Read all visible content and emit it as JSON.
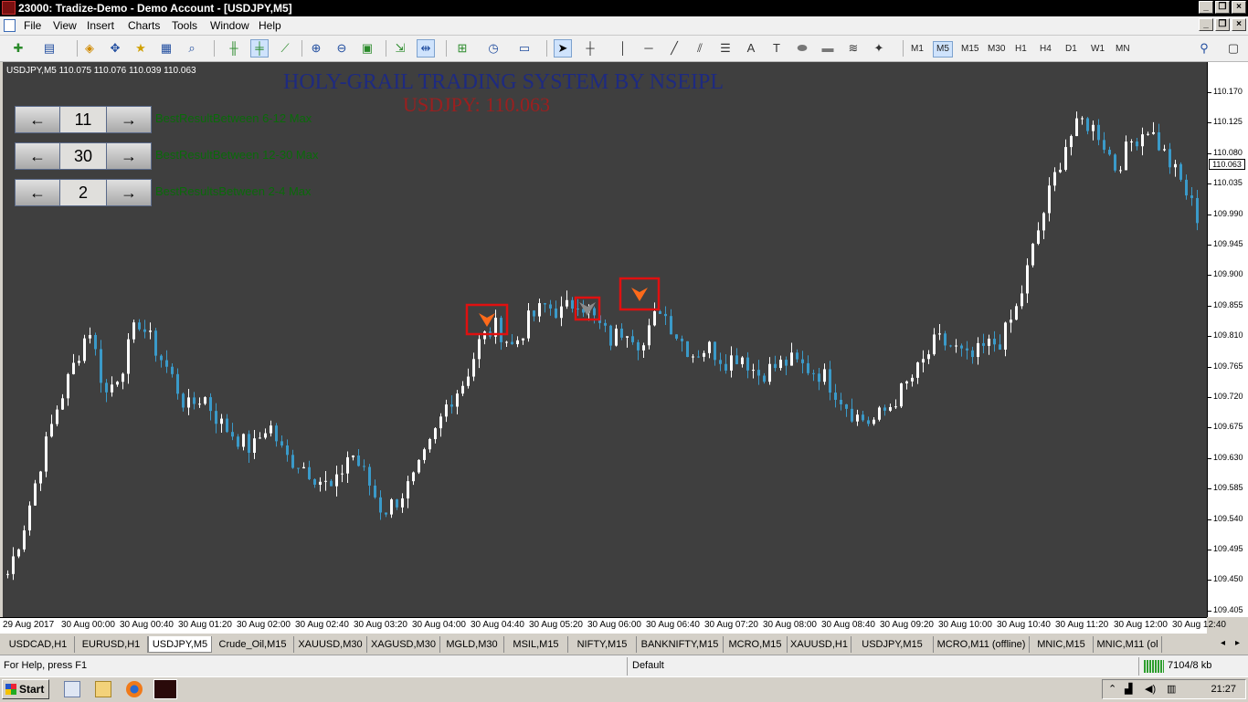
{
  "window": {
    "title": "23000: Tradize-Demo - Demo Account - [USDJPY,M5]"
  },
  "menu": [
    "File",
    "View",
    "Insert",
    "Charts",
    "Tools",
    "Window",
    "Help"
  ],
  "toolbar": {
    "timeframes": [
      "M1",
      "M5",
      "M15",
      "M30",
      "H1",
      "H4",
      "D1",
      "W1",
      "MN"
    ],
    "active_timeframe": "M5"
  },
  "chart": {
    "symbol_line": "USDJPY,M5  110.075 110.076 110.039 110.063",
    "title": "HOLY-GRAIL TRADING SYSTEM BY NSEIPL",
    "price_banner": "USDJPY: 110.063",
    "controls": [
      {
        "value": "11",
        "label": "BestResultBetween 6-12 Max"
      },
      {
        "value": "30",
        "label": "BestResultBetween 12-30 Max"
      },
      {
        "value": "2",
        "label": "BestResultsBetween 2-4 Max"
      }
    ],
    "left_arrow": "←",
    "right_arrow": "→",
    "current_price": "110.063",
    "price_axis": [
      "110.170",
      "110.125",
      "110.080",
      "110.035",
      "109.990",
      "109.945",
      "109.900",
      "109.855",
      "109.810",
      "109.765",
      "109.720",
      "109.675",
      "109.630",
      "109.585",
      "109.540",
      "109.495",
      "109.450",
      "109.405"
    ],
    "time_axis": [
      "29 Aug 2017",
      "30 Aug 00:00",
      "30 Aug 00:40",
      "30 Aug 01:20",
      "30 Aug 02:00",
      "30 Aug 02:40",
      "30 Aug 03:20",
      "30 Aug 04:00",
      "30 Aug 04:40",
      "30 Aug 05:20",
      "30 Aug 06:00",
      "30 Aug 06:40",
      "30 Aug 07:20",
      "30 Aug 08:00",
      "30 Aug 08:40",
      "30 Aug 09:20",
      "30 Aug 10:00",
      "30 Aug 10:40",
      "30 Aug 11:20",
      "30 Aug 12:00",
      "30 Aug 12:40"
    ],
    "colors": {
      "background": "#3f3f3f",
      "bull": "#ffffff",
      "bear": "#3a9ac9",
      "signal": "#ff6a1a",
      "signal_box": "#e01010"
    }
  },
  "chart_data": {
    "type": "candlestick",
    "symbol": "USDJPY",
    "timeframe": "M5",
    "ylim": [
      109.405,
      110.17
    ],
    "close_path": [
      109.46,
      109.53,
      109.62,
      109.7,
      109.76,
      109.82,
      109.72,
      109.76,
      109.83,
      109.79,
      109.75,
      109.7,
      109.72,
      109.68,
      109.66,
      109.64,
      109.68,
      109.63,
      109.62,
      109.6,
      109.58,
      109.64,
      109.6,
      109.55,
      109.57,
      109.6,
      109.65,
      109.71,
      109.74,
      109.8,
      109.82,
      109.79,
      109.83,
      109.85,
      109.84,
      109.86,
      109.83,
      109.8,
      109.82,
      109.79,
      109.85,
      109.81,
      109.78,
      109.79,
      109.77,
      109.78,
      109.75,
      109.76,
      109.77,
      109.76,
      109.75,
      109.72,
      109.69,
      109.68,
      109.7,
      109.73,
      109.76,
      109.8,
      109.79,
      109.77,
      109.79,
      109.8,
      109.85,
      109.94,
      110.02,
      110.09,
      110.12,
      110.1,
      110.05,
      110.09,
      110.11,
      110.07,
      110.03,
      109.98
    ],
    "signals": [
      {
        "time": "30 Aug 04:40",
        "type": "sell"
      },
      {
        "time": "30 Aug 05:30",
        "type": "sell"
      },
      {
        "time": "30 Aug 06:15",
        "type": "sell"
      }
    ]
  },
  "tabs": {
    "items": [
      "USDCAD,H1",
      "EURUSD,H1",
      "USDJPY,M5",
      "Crude_Oil,M15",
      "XAUUSD,M30",
      "XAGUSD,M30",
      "MGLD,M30",
      "MSIL,M15",
      "NIFTY,M15",
      "BANKNIFTY,M15",
      "MCRO,M15",
      "XAUUSD,H1",
      "USDJPY,M15",
      "MCRO,M11 (offline)",
      "MNIC,M15",
      "MNIC,M11 (ol"
    ],
    "active": "USDJPY,M5"
  },
  "status": {
    "help": "For Help, press F1",
    "profile": "Default",
    "connection": "7104/8 kb"
  },
  "taskbar": {
    "start": "Start",
    "clock": "21:27"
  }
}
